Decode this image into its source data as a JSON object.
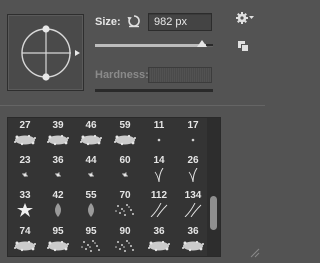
{
  "brush_panel": {
    "size_label": "Size:",
    "size_value": "982 px",
    "hardness_label": "Hardness:",
    "size_level_pct": 94,
    "hardness_level_pct": 100
  },
  "icons": {
    "reset": "reset-size-icon",
    "gear": "gear-icon",
    "new_preset": "new-preset-icon",
    "resize": "resize-grip-icon"
  },
  "presets": [
    {
      "num": "27",
      "tip": "spatter"
    },
    {
      "num": "39",
      "tip": "spatter"
    },
    {
      "num": "46",
      "tip": "spatter"
    },
    {
      "num": "59",
      "tip": "spatter"
    },
    {
      "num": "11",
      "tip": "dot"
    },
    {
      "num": "17",
      "tip": "dot"
    },
    {
      "num": "23",
      "tip": "star"
    },
    {
      "num": "36",
      "tip": "star"
    },
    {
      "num": "44",
      "tip": "star"
    },
    {
      "num": "60",
      "tip": "star"
    },
    {
      "num": "14",
      "tip": "grass"
    },
    {
      "num": "26",
      "tip": "grass"
    },
    {
      "num": "33",
      "tip": "starshape"
    },
    {
      "num": "42",
      "tip": "leaf"
    },
    {
      "num": "55",
      "tip": "leaf"
    },
    {
      "num": "70",
      "tip": "grain"
    },
    {
      "num": "112",
      "tip": "blades"
    },
    {
      "num": "134",
      "tip": "blades"
    },
    {
      "num": "74",
      "tip": "spatter"
    },
    {
      "num": "95",
      "tip": "spatter"
    },
    {
      "num": "95",
      "tip": "grain"
    },
    {
      "num": "90",
      "tip": "grain"
    },
    {
      "num": "36",
      "tip": "spatter"
    },
    {
      "num": "36",
      "tip": "spatter"
    }
  ]
}
